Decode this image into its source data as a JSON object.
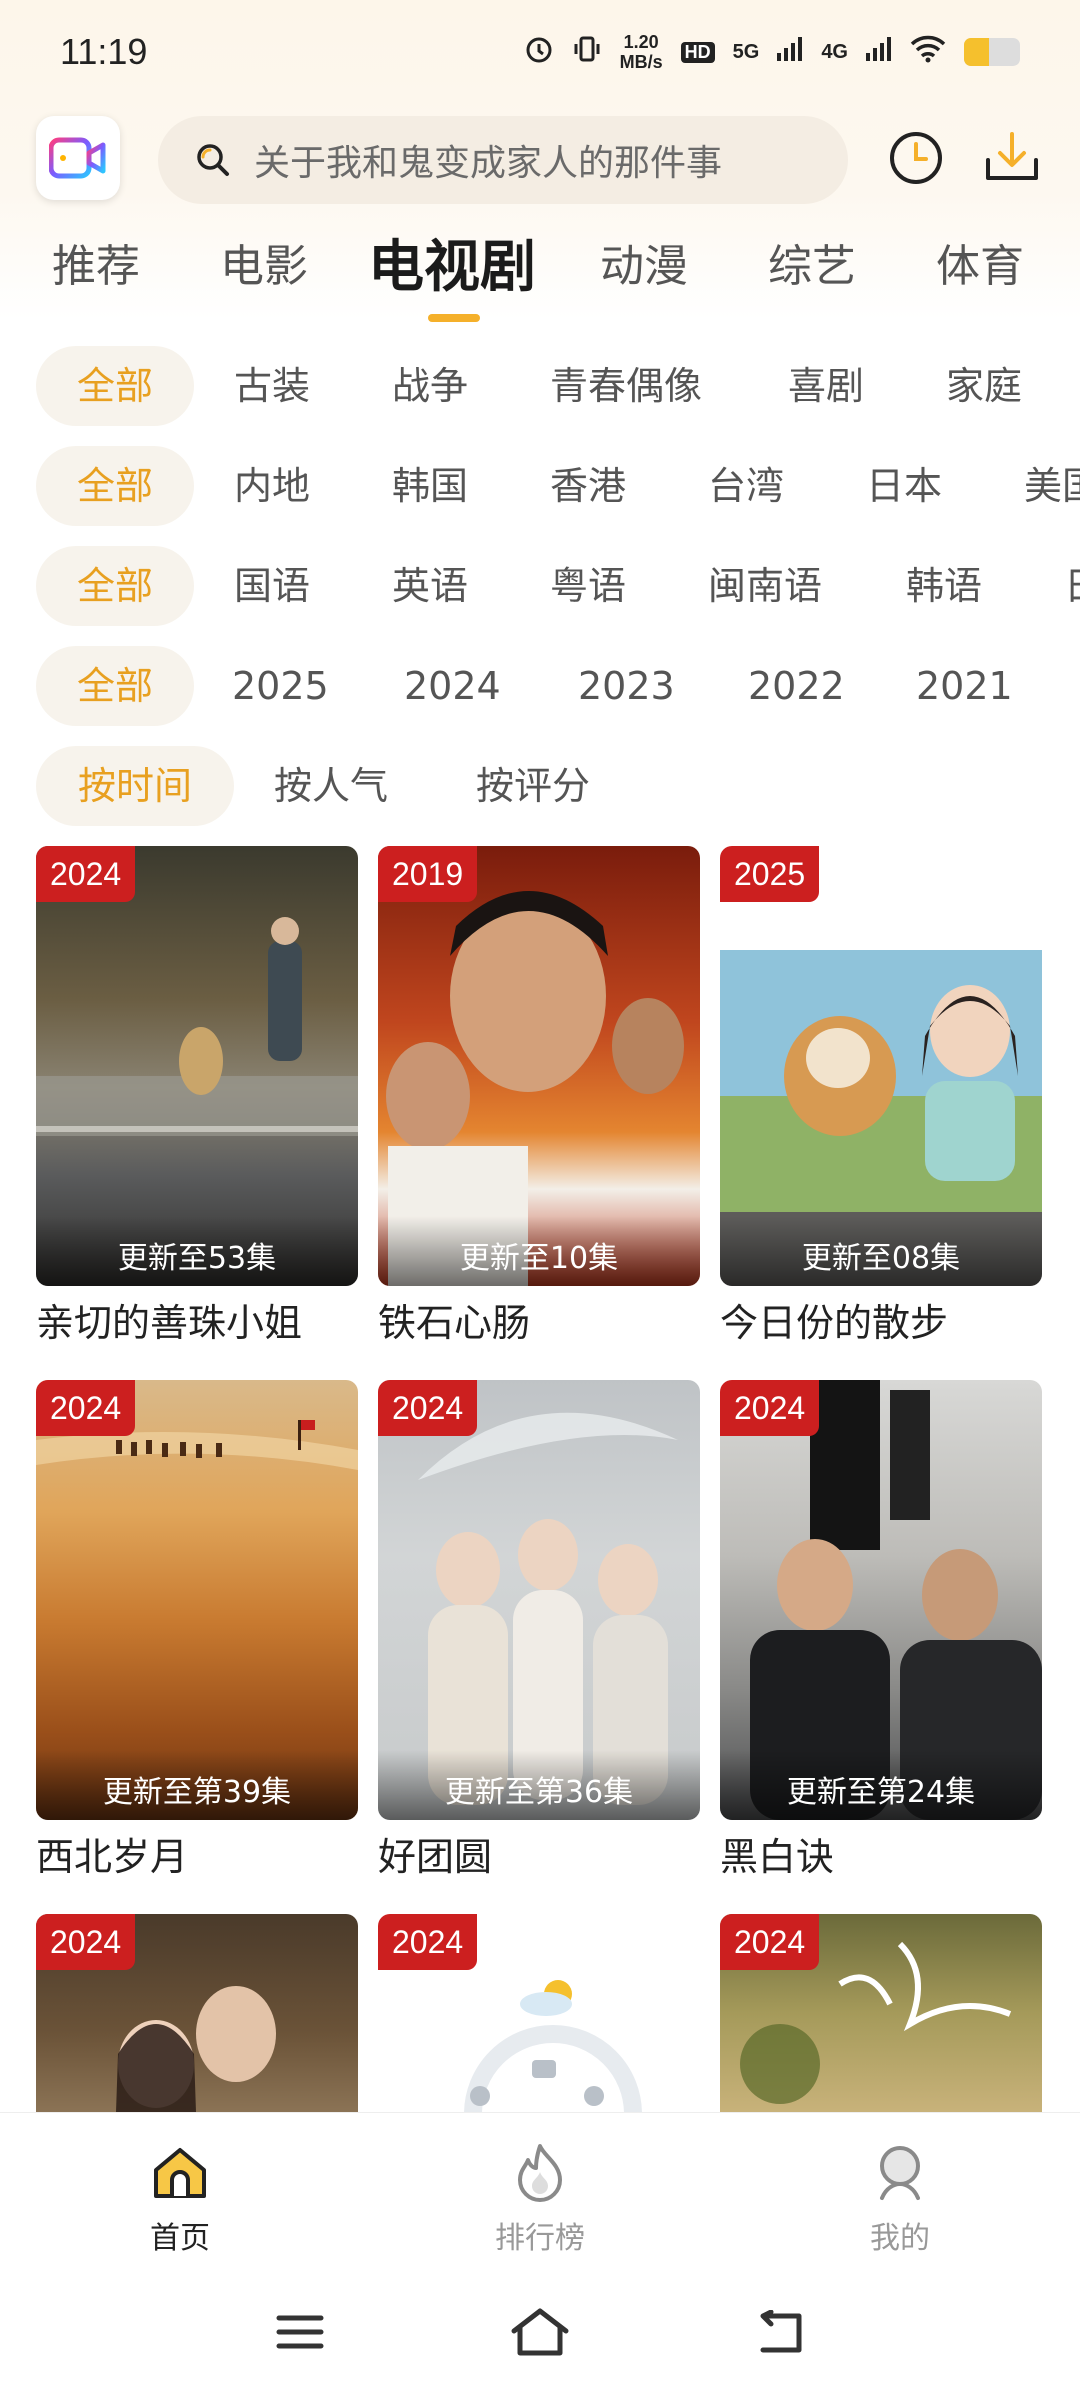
{
  "status_bar": {
    "time": "11:19",
    "net_speed_value": "1.20",
    "net_speed_unit": "MB/s",
    "hd_label": "HD",
    "signal_1": "5G",
    "signal_2": "4G",
    "battery_level": 0.45
  },
  "header": {
    "search_placeholder": "关于我和鬼变成家人的那件事"
  },
  "tabs": [
    {
      "label": "推荐",
      "active": false
    },
    {
      "label": "电影",
      "active": false
    },
    {
      "label": "电视剧",
      "active": true
    },
    {
      "label": "动漫",
      "active": false
    },
    {
      "label": "综艺",
      "active": false
    },
    {
      "label": "体育",
      "active": false
    }
  ],
  "filters": {
    "genre": [
      "全部",
      "古装",
      "战争",
      "青春偶像",
      "喜剧",
      "家庭"
    ],
    "region": [
      "全部",
      "内地",
      "韩国",
      "香港",
      "台湾",
      "日本",
      "美国"
    ],
    "language": [
      "全部",
      "国语",
      "英语",
      "粤语",
      "闽南语",
      "韩语",
      "日语"
    ],
    "year": [
      "全部",
      "2025",
      "2024",
      "2023",
      "2022",
      "2021"
    ],
    "sort": [
      "按时间",
      "按人气",
      "按评分"
    ]
  },
  "cards": [
    {
      "year": "2024",
      "update": "更新至53集",
      "title": "亲切的善珠小姐"
    },
    {
      "year": "2019",
      "update": "更新至10集",
      "title": "铁石心肠"
    },
    {
      "year": "2025",
      "update": "更新至08集",
      "title": "今日份的散步"
    },
    {
      "year": "2024",
      "update": "更新至第39集",
      "title": "西北岁月"
    },
    {
      "year": "2024",
      "update": "更新至第36集",
      "title": "好团圆"
    },
    {
      "year": "2024",
      "update": "更新至第24集",
      "title": "黑白诀"
    },
    {
      "year": "2024",
      "update": "",
      "title": ""
    },
    {
      "year": "2024",
      "update": "",
      "title": ""
    },
    {
      "year": "2024",
      "update": "",
      "title": ""
    }
  ],
  "bottom_nav": [
    {
      "label": "首页",
      "icon": "home-icon",
      "active": true
    },
    {
      "label": "排行榜",
      "icon": "flame-icon",
      "active": false
    },
    {
      "label": "我的",
      "icon": "profile-icon",
      "active": false
    }
  ],
  "colors": {
    "accent": "#f5b02a",
    "chip_active_text": "#e8a020",
    "badge": "#cc1f1f"
  }
}
